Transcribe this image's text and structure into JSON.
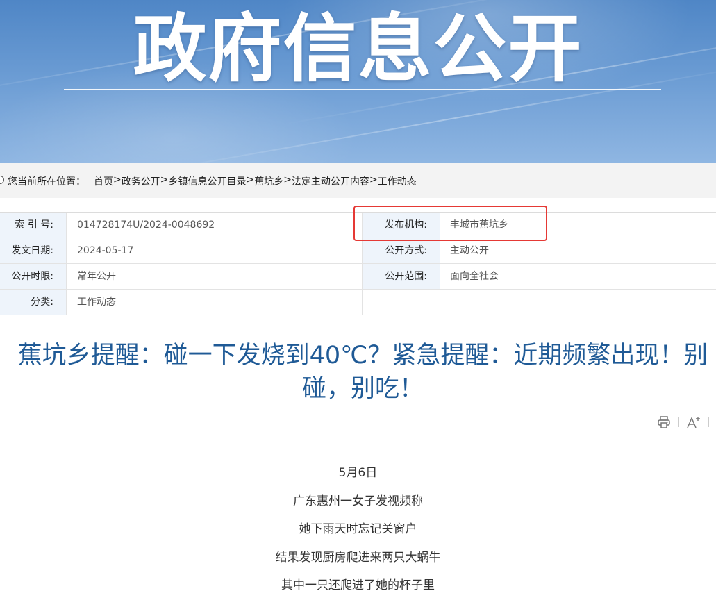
{
  "banner": {
    "title": "政府信息公开"
  },
  "breadcrumb": {
    "label": "您当前所在位置：",
    "items": [
      "首页",
      "政务公开",
      "乡镇信息公开目录",
      "蕉坑乡",
      "法定主动公开内容",
      "工作动态"
    ],
    "separator": ">"
  },
  "info": {
    "index_label": "索 引 号:",
    "index_value": "014728174U/2024-0048692",
    "publisher_label": "发布机构:",
    "publisher_value": "丰城市蕉坑乡",
    "date_label": "发文日期:",
    "date_value": "2024-05-17",
    "method_label": "公开方式:",
    "method_value": "主动公开",
    "period_label": "公开时限:",
    "period_value": "常年公开",
    "scope_label": "公开范围:",
    "scope_value": "面向全社会",
    "category_label": "分类:",
    "category_value": "工作动态"
  },
  "article": {
    "title_line1": "蕉坑乡提醒：碰一下发烧到40℃？紧急提醒：近期频繁出现！别",
    "title_line2": "碰，别吃！",
    "body": [
      "5月6日",
      "广东惠州一女子发视频称",
      "她下雨天时忘记关窗户",
      "结果发现厨房爬进来两只大蜗牛",
      "其中一只还爬进了她的杯子里"
    ]
  },
  "colors": {
    "title_blue": "#1f5a96",
    "highlight_red": "#e53935",
    "label_bg": "#eef4fb"
  }
}
